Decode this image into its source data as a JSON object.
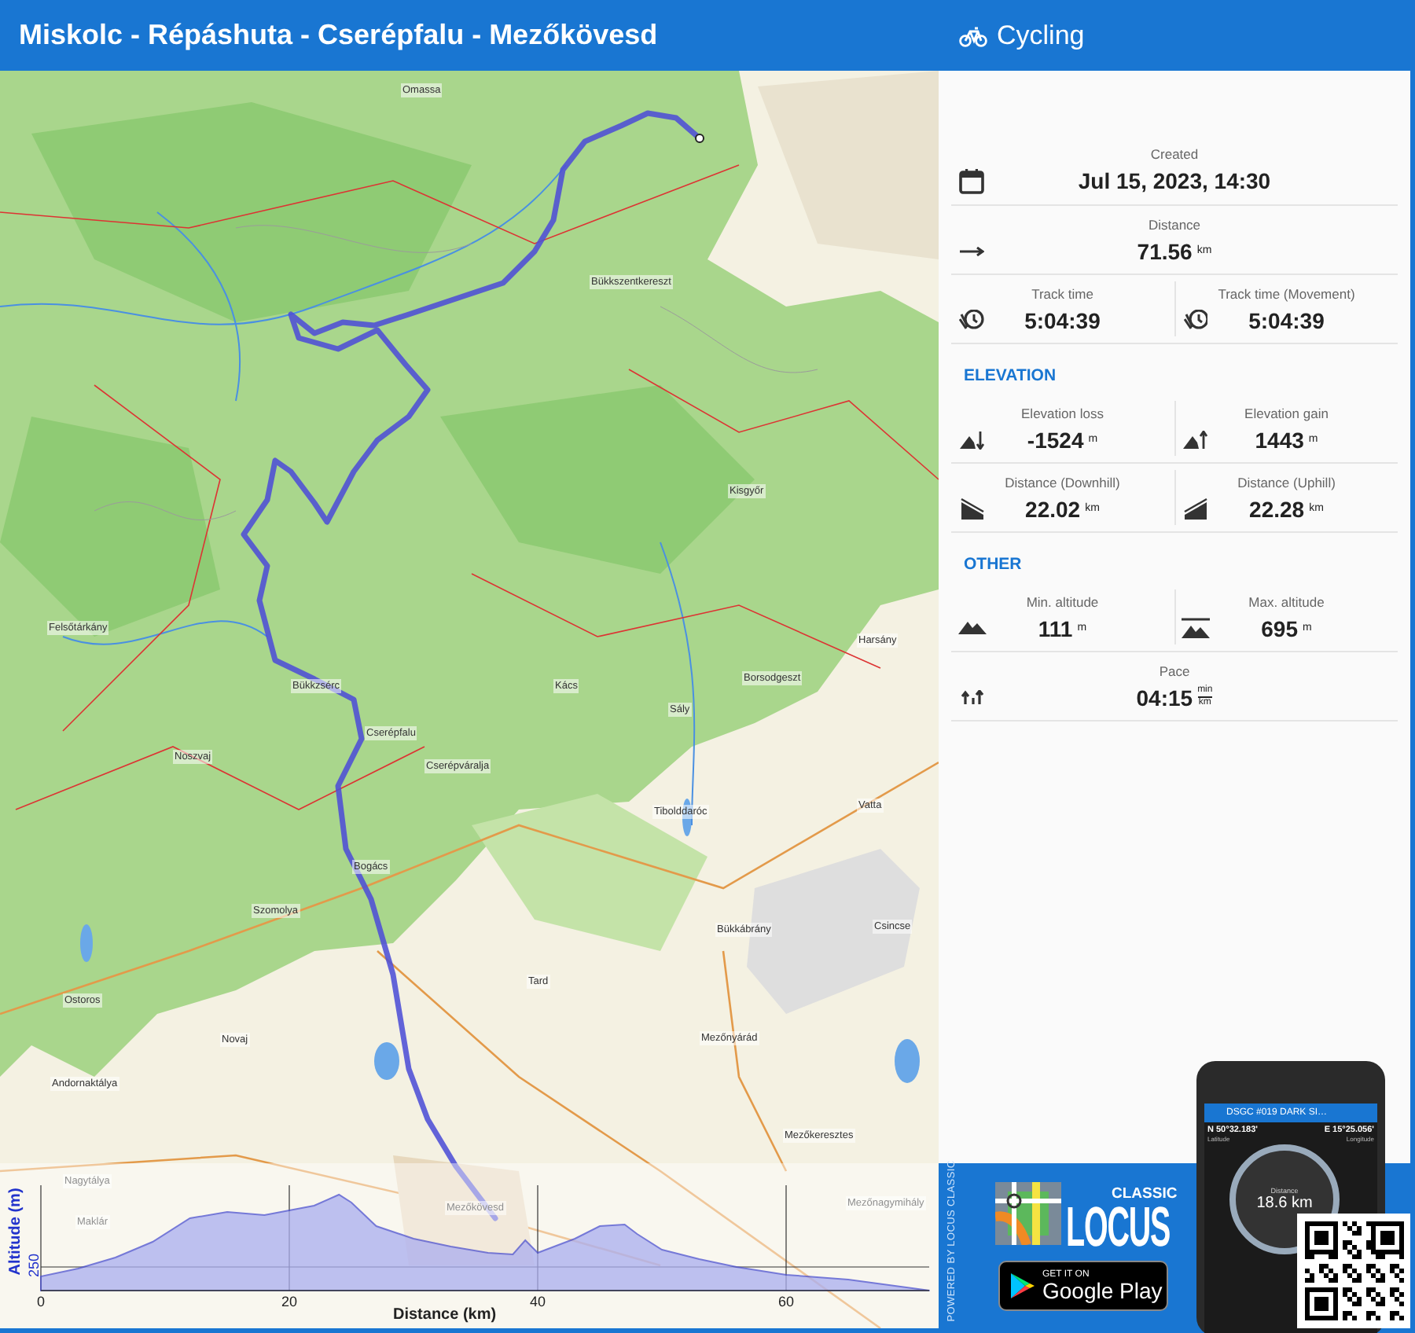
{
  "header": {
    "title": "Miskolc - Répáshuta - Cserépfalu - Mezőkövesd",
    "activity": "Cycling"
  },
  "map": {
    "places": [
      {
        "name": "Omassa"
      },
      {
        "name": "Bükkszentkereszt"
      },
      {
        "name": "Kisgyőr"
      },
      {
        "name": "Felsőtárkány"
      },
      {
        "name": "Bükkzsérc"
      },
      {
        "name": "Kács"
      },
      {
        "name": "Borsodgeszt"
      },
      {
        "name": "Harsány"
      },
      {
        "name": "Cserépfalu"
      },
      {
        "name": "Sály"
      },
      {
        "name": "Noszvaj"
      },
      {
        "name": "Cserépváralja"
      },
      {
        "name": "Tibolddaróc"
      },
      {
        "name": "Vatta"
      },
      {
        "name": "Bogács"
      },
      {
        "name": "Szomolya"
      },
      {
        "name": "Bükkábrány"
      },
      {
        "name": "Csincse"
      },
      {
        "name": "Ostoros"
      },
      {
        "name": "Tard"
      },
      {
        "name": "Novaj"
      },
      {
        "name": "Mezőnyárád"
      },
      {
        "name": "Andornaktálya"
      },
      {
        "name": "Mezőkeresztes"
      },
      {
        "name": "Nagytálya"
      },
      {
        "name": "Maklár"
      },
      {
        "name": "Mezőkövesd"
      },
      {
        "name": "Mezőnagymihály"
      }
    ]
  },
  "elevation_chart": {
    "ylabel": "Altitude (m)",
    "y_tick": "250",
    "x_ticks": [
      "0",
      "20",
      "40",
      "60"
    ],
    "xlabel": "Distance (km)"
  },
  "stats": [
    {
      "kind": "row",
      "cells": [
        {
          "kind": "calendar",
          "label": "Created",
          "value": "Jul 15, 2023, 14:30"
        }
      ]
    },
    {
      "kind": "row",
      "cells": [
        {
          "kind": "distance",
          "label": "Distance",
          "value": "71.56",
          "unit": "km"
        }
      ]
    },
    {
      "kind": "row",
      "cells": [
        {
          "kind": "timer",
          "label": "Track time",
          "value": "5:04:39"
        },
        {
          "kind": "timer",
          "label": "Track time (Movement)",
          "value": "5:04:39"
        }
      ]
    },
    {
      "kind": "section",
      "title": "ELEVATION"
    },
    {
      "kind": "row",
      "cells": [
        {
          "kind": "elevation-loss",
          "label": "Elevation loss",
          "value": "-1524",
          "unit": "m"
        },
        {
          "kind": "elevation-gain",
          "label": "Elevation gain",
          "value": "1443",
          "unit": "m"
        }
      ]
    },
    {
      "kind": "row",
      "cells": [
        {
          "kind": "downhill",
          "label": "Distance (Downhill)",
          "value": "22.02",
          "unit": "km"
        },
        {
          "kind": "uphill",
          "label": "Distance (Uphill)",
          "value": "22.28",
          "unit": "km"
        }
      ]
    },
    {
      "kind": "section",
      "title": "OTHER"
    },
    {
      "kind": "row",
      "cells": [
        {
          "kind": "min-altitude",
          "label": "Min. altitude",
          "value": "111",
          "unit": "m"
        },
        {
          "kind": "max-altitude",
          "label": "Max. altitude",
          "value": "695",
          "unit": "m"
        }
      ]
    },
    {
      "kind": "row",
      "cells": [
        {
          "kind": "pace",
          "label": "Pace",
          "value": "04:15",
          "unit": "min",
          "unit_denominator": "km"
        }
      ]
    }
  ],
  "promo": {
    "tagline": "POWERED BY LOCUS CLASSIC",
    "logo_edition": "CLASSIC",
    "logo_name": "LOCUS",
    "store_line1": "GET IT ON",
    "store_line2": "Google Play",
    "phone": {
      "title": "DSGC #019 DARK SI…",
      "latitude": "N 50°32.183'",
      "latitude_label": "Latitude",
      "longitude": "E 15°25.056'",
      "longitude_label": "Longitude",
      "distance_label": "Distance",
      "distance": "18.6 km"
    }
  }
}
